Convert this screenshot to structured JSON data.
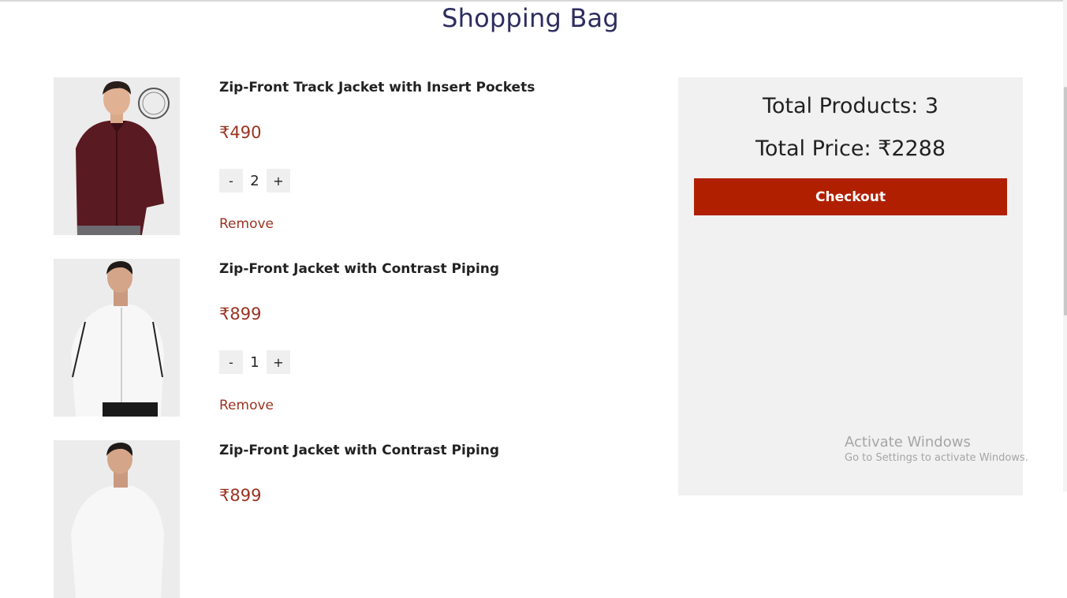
{
  "page": {
    "title": "Shopping Bag"
  },
  "cart": {
    "items": [
      {
        "name": "Zip-Front Track Jacket with Insert Pockets",
        "price": "₹490",
        "quantity": "2",
        "decrement": "-",
        "increment": "+",
        "remove": "Remove",
        "jacket_color": "#5a1a22"
      },
      {
        "name": "Zip-Front Jacket with Contrast Piping",
        "price": "₹899",
        "quantity": "1",
        "decrement": "-",
        "increment": "+",
        "remove": "Remove",
        "jacket_color": "#f7f7f7"
      },
      {
        "name": "Zip-Front Jacket with Contrast Piping",
        "price": "₹899",
        "jacket_color": "#f7f7f7"
      }
    ]
  },
  "summary": {
    "total_products": "Total Products: 3",
    "total_price": "Total Price: ₹2288",
    "checkout": "Checkout"
  },
  "watermark": {
    "title": "Activate Windows",
    "subtitle": "Go to Settings to activate Windows."
  },
  "colors": {
    "title": "#2e2d60",
    "accent": "#9b3320",
    "checkout_bg": "#b02000",
    "summary_bg": "#f1f1f1"
  }
}
